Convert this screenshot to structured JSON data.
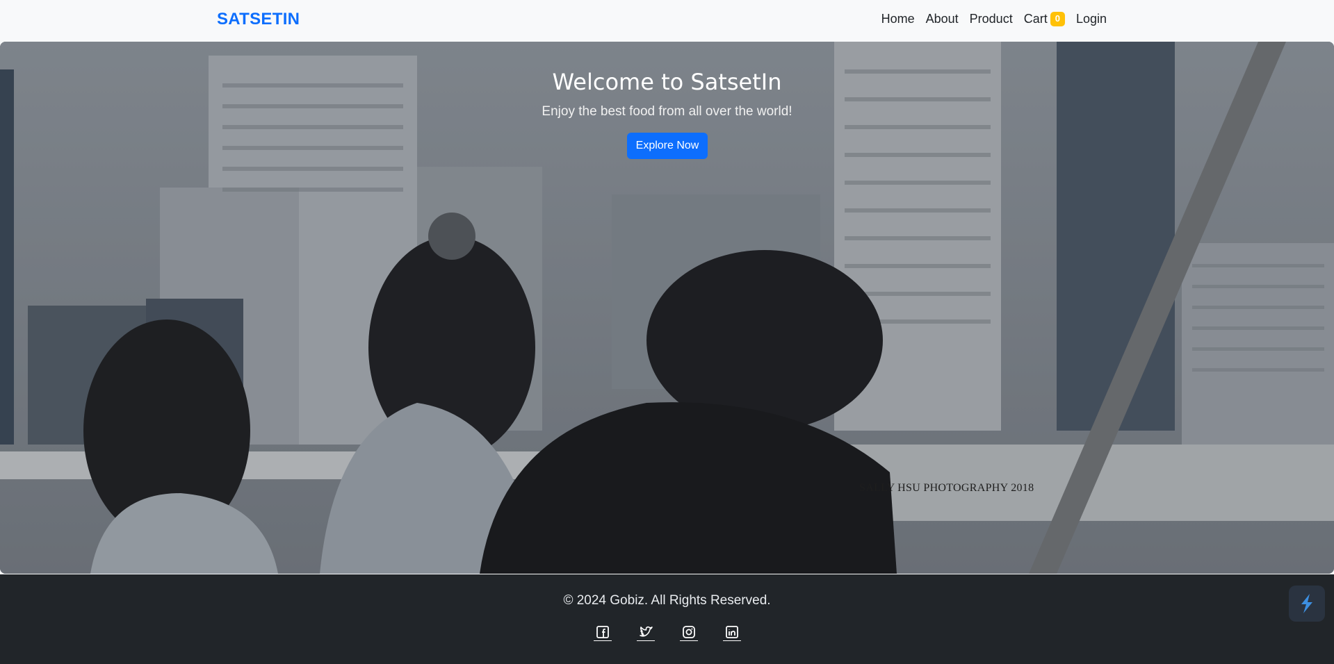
{
  "navbar": {
    "brand": "SATSETIN",
    "links": [
      {
        "label": "Home"
      },
      {
        "label": "About"
      },
      {
        "label": "Product"
      },
      {
        "label": "Cart"
      },
      {
        "label": "Login"
      }
    ],
    "cart_count": "0"
  },
  "hero": {
    "title": "Welcome to SatsetIn",
    "subtitle": "Enjoy the best food from all over the world!",
    "button_label": "Explore Now",
    "photo_watermark": "SALLY HSU PHOTOGRAPHY 2018"
  },
  "footer": {
    "copyright": "© 2024 Gobiz. All Rights Reserved.",
    "socials": [
      {
        "icon": "facebook-icon"
      },
      {
        "icon": "twitter-icon"
      },
      {
        "icon": "instagram-icon"
      },
      {
        "icon": "linkedin-icon"
      }
    ]
  },
  "colors": {
    "brand": "#0d6efd",
    "badge": "#ffc107",
    "footer_bg": "#212529"
  }
}
